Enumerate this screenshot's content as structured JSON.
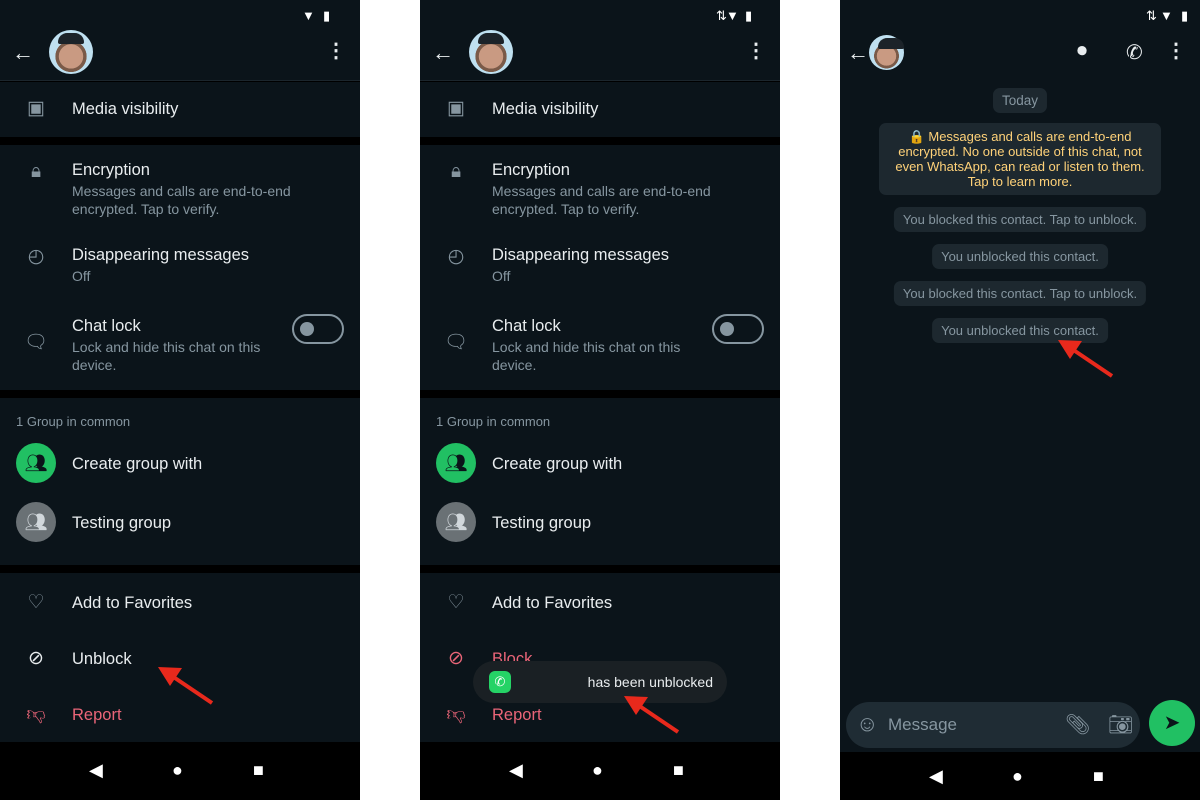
{
  "info_screen": {
    "media_visibility": "Media visibility",
    "encryption": {
      "title": "Encryption",
      "subtitle": "Messages and calls are end-to-end encrypted. Tap to verify."
    },
    "disappearing": {
      "title": "Disappearing messages",
      "subtitle": "Off"
    },
    "chat_lock": {
      "title": "Chat lock",
      "subtitle": "Lock and hide this chat on this device.",
      "enabled": false
    },
    "groups_header": "1 Group in common",
    "create_group": "Create group with",
    "testing_group": "Testing group",
    "add_favorites": "Add to Favorites",
    "report": "Report"
  },
  "panel1": {
    "block_label": "Unblock"
  },
  "panel2": {
    "block_label": "Block",
    "toast": "has been unblocked"
  },
  "chat": {
    "date": "Today",
    "encryption_notice": "🔒 Messages and calls are end-to-end encrypted. No one outside of this chat, not even WhatsApp, can read or listen to them. Tap to learn more.",
    "events": [
      "You blocked this contact. Tap to unblock.",
      "You unblocked this contact.",
      "You blocked this contact. Tap to unblock.",
      "You unblocked this contact."
    ],
    "input_placeholder": "Message"
  },
  "colors": {
    "accent": "#21c063",
    "danger": "#ea6578",
    "background": "#0b141a",
    "annotation_arrow": "#e8291c"
  }
}
